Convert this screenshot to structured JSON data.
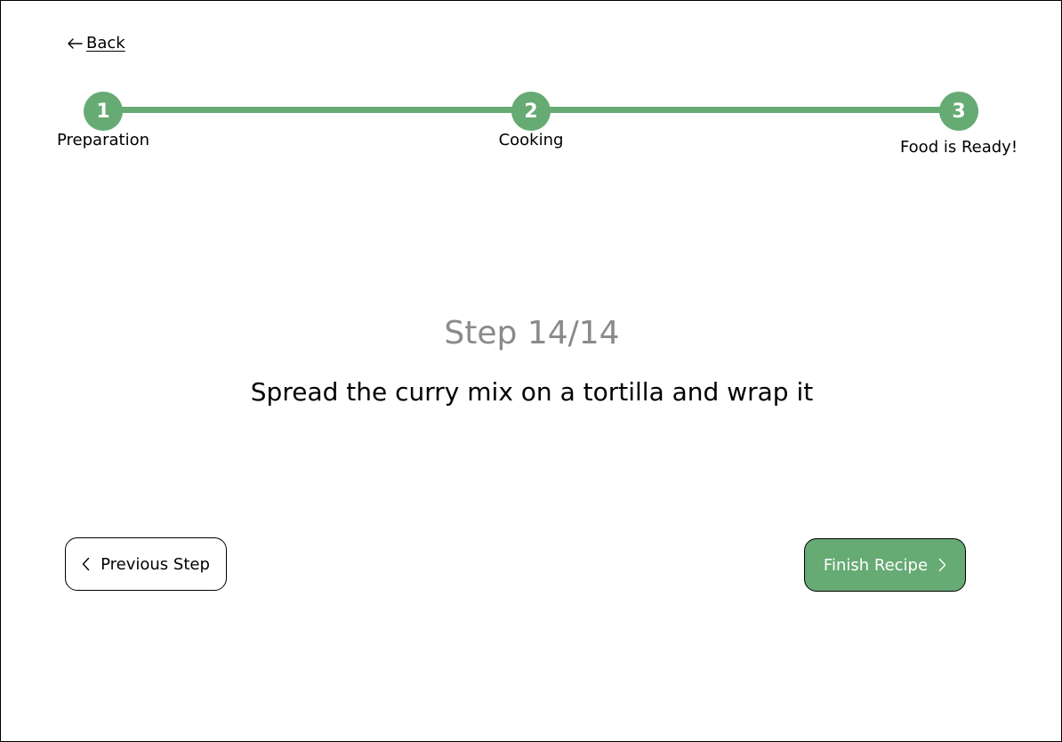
{
  "back": {
    "label": "Back",
    "icon": "arrow-left-icon"
  },
  "progress": {
    "accent_color": "#66aa74",
    "steps": [
      {
        "number": "1",
        "label": "Preparation"
      },
      {
        "number": "2",
        "label": "Cooking"
      },
      {
        "number": "3",
        "label": "Food is Ready!"
      }
    ]
  },
  "step": {
    "title": "Step 14/14",
    "instruction": "Spread the curry mix on a tortilla and wrap it"
  },
  "buttons": {
    "previous_label": "Previous Step",
    "previous_icon": "chevron-left-icon",
    "finish_label": "Finish Recipe",
    "finish_icon": "chevron-right-icon"
  }
}
